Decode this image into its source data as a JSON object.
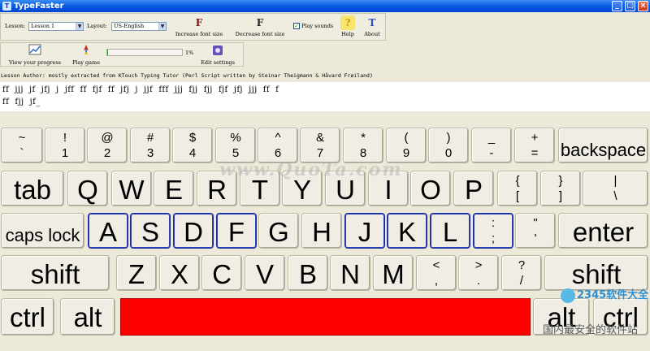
{
  "window": {
    "title": "TypeFaster",
    "app_icon_glyph": "T",
    "controls": {
      "minimize": "_",
      "maximize": "□",
      "close": "×"
    }
  },
  "toolbar": {
    "lesson_label": "Lesson:",
    "lesson_value": "Lesson 1",
    "layout_label": "Layout:",
    "layout_value": "US-English",
    "increase_font": {
      "label": "Increase font size",
      "icon": "F"
    },
    "decrease_font": {
      "label": "Decrease font size",
      "icon": "F"
    },
    "play_sounds": {
      "label": "Play sounds",
      "checked": true
    },
    "help": {
      "label": "Help",
      "icon": "?"
    },
    "about": {
      "label": "About",
      "icon": "T"
    },
    "view_progress": {
      "label": "View your progress"
    },
    "play_game": {
      "label": "Play game"
    },
    "progress_percent": "1%",
    "progress_value": 0.01,
    "edit_settings": {
      "label": "Edit settings"
    }
  },
  "lesson_author": "Lesson Author: mostly extracted from KTouch Typing Tutor (Perl Script written by Steinar Theigmann & Håvard Frøiland)",
  "lesson_text": {
    "line1": "ff  jjj  jf  jfj  j  jff  ff  fjf  ff  jfj  j  jjf  fff  jjj  fjj  fjj  fjf  jfj  jjj  ff  f",
    "line2": "ff  fjj  jf_"
  },
  "keyboard": {
    "row1": [
      {
        "top": "~",
        "bot": "`"
      },
      {
        "top": "!",
        "bot": "1"
      },
      {
        "top": "@",
        "bot": "2"
      },
      {
        "top": "#",
        "bot": "3"
      },
      {
        "top": "$",
        "bot": "4"
      },
      {
        "top": "%",
        "bot": "5"
      },
      {
        "top": "^",
        "bot": "6"
      },
      {
        "top": "&",
        "bot": "7"
      },
      {
        "top": "*",
        "bot": "8"
      },
      {
        "top": "(",
        "bot": "9"
      },
      {
        "top": ")",
        "bot": "0"
      },
      {
        "top": "_",
        "bot": "-"
      },
      {
        "top": "+",
        "bot": "="
      },
      {
        "word": "backspace"
      }
    ],
    "row2": [
      {
        "word": "tab"
      },
      {
        "big": "Q"
      },
      {
        "big": "W"
      },
      {
        "big": "E"
      },
      {
        "big": "R"
      },
      {
        "big": "T"
      },
      {
        "big": "Y"
      },
      {
        "big": "U"
      },
      {
        "big": "I"
      },
      {
        "big": "O"
      },
      {
        "big": "P"
      },
      {
        "top": "{",
        "bot": "["
      },
      {
        "top": "}",
        "bot": "]"
      },
      {
        "top": "|",
        "bot": "\\"
      }
    ],
    "row3": [
      {
        "word": "caps lock"
      },
      {
        "big": "A"
      },
      {
        "big": "S"
      },
      {
        "big": "D"
      },
      {
        "big": "F"
      },
      {
        "big": "G"
      },
      {
        "big": "H"
      },
      {
        "big": "J"
      },
      {
        "big": "K"
      },
      {
        "big": "L"
      },
      {
        "top": ":",
        "bot": ";"
      },
      {
        "top": "\"",
        "bot": "'"
      },
      {
        "word": "enter"
      }
    ],
    "row4": [
      {
        "word": "shift"
      },
      {
        "big": "Z"
      },
      {
        "big": "X"
      },
      {
        "big": "C"
      },
      {
        "big": "V"
      },
      {
        "big": "B"
      },
      {
        "big": "N"
      },
      {
        "big": "M"
      },
      {
        "top": "<",
        "bot": ","
      },
      {
        "top": ">",
        "bot": "."
      },
      {
        "top": "?",
        "bot": "/"
      },
      {
        "word": "shift"
      }
    ],
    "row5": [
      {
        "word": "ctrl"
      },
      {
        "word": "alt"
      },
      {
        "word": "alt"
      },
      {
        "word": "ctrl"
      }
    ],
    "highlighted_keys": [
      "A",
      "S",
      "D",
      "F",
      "J",
      "K",
      "L",
      ";"
    ],
    "highlight_color": "#1a2d9c",
    "space_color": "#ff0000"
  },
  "watermark": "www.QuoTa.com",
  "corner_logo": {
    "text": "2345软件大全",
    "sub": "国内最安全的软件站"
  }
}
